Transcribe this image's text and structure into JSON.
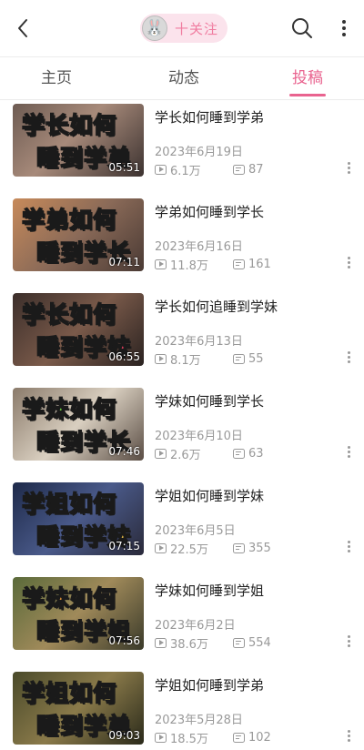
{
  "header": {
    "follow_label": "十关注",
    "avatar_glyph": "🐰"
  },
  "tabs": [
    {
      "label": "主页",
      "active": false
    },
    {
      "label": "动态",
      "active": false
    },
    {
      "label": "投稿",
      "active": true
    }
  ],
  "colors": {
    "accent": "#e9638f",
    "follow_bg": "#fbe3ec",
    "follow_text": "#f07ca0",
    "meta_text": "#999999"
  },
  "videos": [
    {
      "thumb_line1": "学长如何",
      "thumb_line2": "睡到学弟",
      "duration": "05:51",
      "title": "学长如何睡到学弟",
      "date": "2023年6月19日",
      "views": "6.1万",
      "comments": "87"
    },
    {
      "thumb_line1": "学弟如何",
      "thumb_line2": "睡到学长",
      "duration": "07:11",
      "title": "学弟如何睡到学长",
      "date": "2023年6月16日",
      "views": "11.8万",
      "comments": "161"
    },
    {
      "thumb_line1": "学长如何",
      "thumb_line2": "睡到学妹",
      "duration": "06:55",
      "title": "学长如何追睡到学妹",
      "date": "2023年6月13日",
      "views": "8.1万",
      "comments": "55"
    },
    {
      "thumb_line1": "学妹如何",
      "thumb_line2": "睡到学长",
      "duration": "07:46",
      "title": "学妹如何睡到学长",
      "date": "2023年6月10日",
      "views": "2.6万",
      "comments": "63"
    },
    {
      "thumb_line1": "学姐如何",
      "thumb_line2": "睡到学妹",
      "duration": "07:15",
      "title": "学姐如何睡到学妹",
      "date": "2023年6月5日",
      "views": "22.5万",
      "comments": "355"
    },
    {
      "thumb_line1": "学妹如何",
      "thumb_line2": "睡到学姐",
      "duration": "07:56",
      "title": "学妹如何睡到学姐",
      "date": "2023年6月2日",
      "views": "38.6万",
      "comments": "554"
    },
    {
      "thumb_line1": "学姐如何",
      "thumb_line2": "睡到学弟",
      "duration": "09:03",
      "title": "学姐如何睡到学弟",
      "date": "2023年5月28日",
      "views": "18.5万",
      "comments": "102"
    }
  ]
}
